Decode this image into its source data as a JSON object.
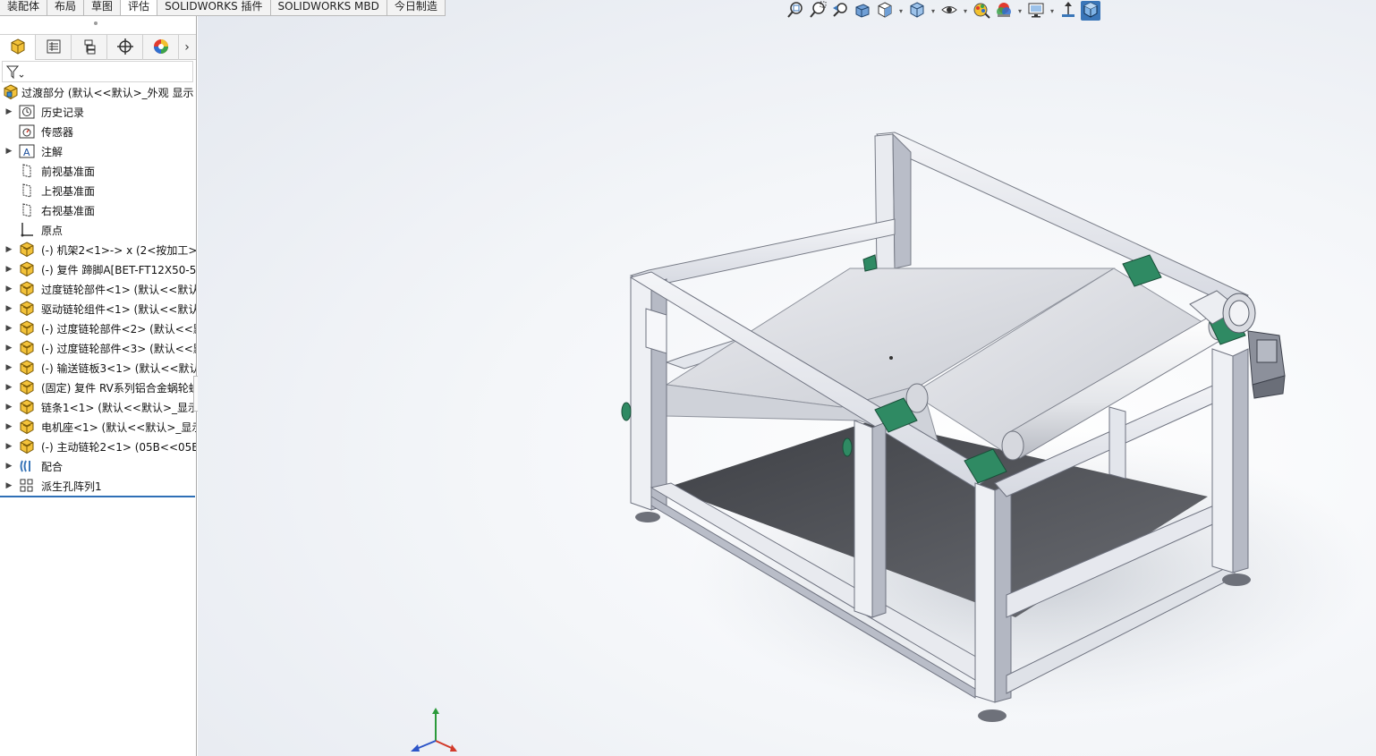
{
  "command_tabs": [
    {
      "label": "装配体"
    },
    {
      "label": "布局"
    },
    {
      "label": "草图"
    },
    {
      "label": "评估"
    },
    {
      "label": "SOLIDWORKS 插件"
    },
    {
      "label": "SOLIDWORKS MBD"
    },
    {
      "label": "今日制造"
    }
  ],
  "panel_tabs": [
    {
      "icon": "feature-manager-icon"
    },
    {
      "icon": "property-manager-icon"
    },
    {
      "icon": "configuration-manager-icon"
    },
    {
      "icon": "dimxpert-manager-icon"
    },
    {
      "icon": "display-manager-icon"
    }
  ],
  "feature_tree": {
    "root": {
      "label": "过渡部分  (默认<<默认>_外观 显示",
      "icon": "assembly-icon"
    },
    "items": [
      {
        "label": "历史记录",
        "icon": "history-icon",
        "expandable": true
      },
      {
        "label": "传感器",
        "icon": "sensor-icon",
        "expandable": false
      },
      {
        "label": "注解",
        "icon": "annotation-icon",
        "expandable": true
      },
      {
        "label": "前视基准面",
        "icon": "plane-icon",
        "expandable": false
      },
      {
        "label": "上视基准面",
        "icon": "plane-icon",
        "expandable": false
      },
      {
        "label": "右视基准面",
        "icon": "plane-icon",
        "expandable": false
      },
      {
        "label": "原点",
        "icon": "origin-icon",
        "expandable": false
      },
      {
        "label": "(-) 机架2<1>-> x (2<按加工>-",
        "icon": "subassembly-icon",
        "expandable": true
      },
      {
        "label": "(-) 复件 蹄脚A[BET-FT12X50-5",
        "icon": "subassembly-icon",
        "expandable": true
      },
      {
        "label": "过度链轮部件<1> (默认<<默认",
        "icon": "subassembly-icon",
        "expandable": true
      },
      {
        "label": "驱动链轮组件<1> (默认<<默认",
        "icon": "subassembly-icon",
        "expandable": true
      },
      {
        "label": "(-) 过度链轮部件<2> (默认<<默",
        "icon": "subassembly-icon",
        "expandable": true
      },
      {
        "label": "(-) 过度链轮部件<3> (默认<<默",
        "icon": "subassembly-icon",
        "expandable": true
      },
      {
        "label": "(-) 输送链板3<1> (默认<<默认",
        "icon": "subassembly-icon",
        "expandable": true
      },
      {
        "label": "(固定) 复件 RV系列铝合金蜗轮蜗",
        "icon": "subassembly-icon",
        "expandable": true
      },
      {
        "label": "链条1<1> (默认<<默认>_显示",
        "icon": "subassembly-icon",
        "expandable": true
      },
      {
        "label": "电机座<1> (默认<<默认>_显示",
        "icon": "subassembly-icon",
        "expandable": true
      },
      {
        "label": "(-) 主动链轮2<1> (05B<<05B",
        "icon": "subassembly-icon",
        "expandable": true
      },
      {
        "label": "配合",
        "icon": "mates-icon",
        "expandable": true
      },
      {
        "label": "派生孔阵列1",
        "icon": "pattern-icon",
        "expandable": true
      }
    ]
  },
  "hud_toolbar": [
    {
      "icon": "zoom-to-fit-icon",
      "dropdown": false
    },
    {
      "icon": "zoom-to-area-icon",
      "dropdown": false
    },
    {
      "icon": "previous-view-icon",
      "dropdown": false
    },
    {
      "icon": "section-view-icon",
      "dropdown": false
    },
    {
      "icon": "view-orientation-icon",
      "dropdown": true
    },
    {
      "icon": "display-style-icon",
      "dropdown": true
    },
    {
      "icon": "hide-show-items-icon",
      "dropdown": true
    },
    {
      "icon": "edit-appearance-icon",
      "dropdown": false
    },
    {
      "icon": "apply-scene-icon",
      "dropdown": true
    },
    {
      "icon": "view-settings-icon",
      "dropdown": true
    },
    {
      "icon": "rotate-view-icon",
      "dropdown": false
    },
    {
      "icon": "isometric-cube-icon",
      "dropdown": false
    }
  ],
  "colors": {
    "frame": "#e6e8ee",
    "frame_shade": "#aeb3c0",
    "belt": "#d9dbe0",
    "bearing": "#2f8a63",
    "floor_panel": "#505257",
    "selection": "#2f6fb6"
  }
}
